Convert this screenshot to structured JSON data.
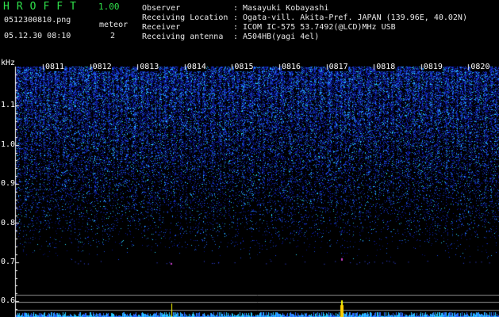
{
  "app": {
    "title": "HROFFT",
    "version": "1.00"
  },
  "file": {
    "name": "0512300810.png",
    "datetime": "05.12.30 08:10"
  },
  "meteor": {
    "label": "meteor",
    "count": "2"
  },
  "info": [
    {
      "key": "Observer",
      "value": "Masayuki Kobayashi"
    },
    {
      "key": "Receiving Location",
      "value": "Ogata-vill. Akita-Pref. JAPAN (139.96E, 40.02N)"
    },
    {
      "key": "Receiver",
      "value": "ICOM IC-575 53.7492(@LCD)MHz USB"
    },
    {
      "key": "Receiving antenna",
      "value": "A504HB(yagi 4el)"
    }
  ],
  "sep": ":",
  "axis": {
    "unit": "kHz",
    "y_ticks": [
      "1.1",
      "1.0",
      "0.9",
      "0.8",
      "0.7",
      "0.6"
    ],
    "y_tick_values": [
      1.1,
      1.0,
      0.9,
      0.8,
      0.7,
      0.6
    ],
    "y_range": [
      0.56,
      1.2
    ],
    "time_labels": [
      "0811",
      "0812",
      "0813",
      "0814",
      "0815",
      "0816",
      "0817",
      "0818",
      "0819",
      "0820"
    ]
  },
  "colors": {
    "title_green": "#2fe04a",
    "noise_dark": "#0b0f6e",
    "noise_mid": "#2a3cd8",
    "noise_bright": "#2fd0ff",
    "tick_line": "#ffffff",
    "meteor_yellow": "#ffff00"
  }
}
